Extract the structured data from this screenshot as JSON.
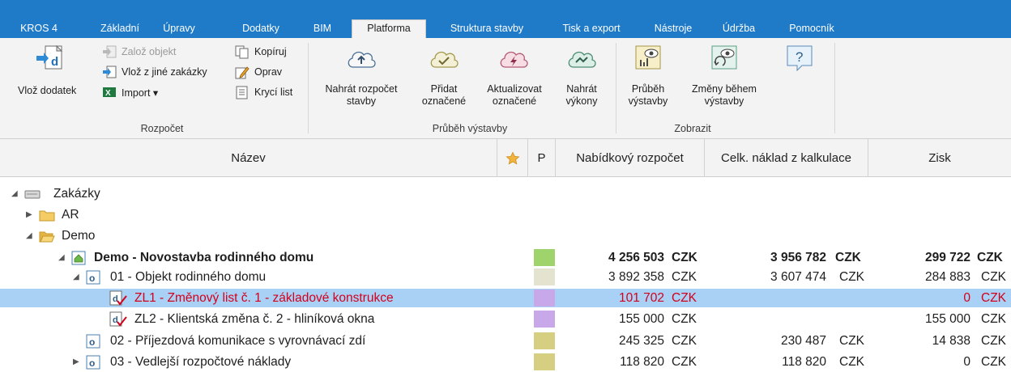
{
  "tabs": [
    {
      "label": "KROS 4"
    },
    {
      "label": "Základní"
    },
    {
      "label": "Úpravy"
    },
    {
      "label": "Dodatky"
    },
    {
      "label": "BIM"
    },
    {
      "label": "Platforma"
    },
    {
      "label": "Struktura stavby"
    },
    {
      "label": "Tisk a export"
    },
    {
      "label": "Nástroje"
    },
    {
      "label": "Údržba"
    },
    {
      "label": "Pomocník"
    }
  ],
  "active_tab": "Platforma",
  "ribbon": {
    "rozpocet": {
      "vloz_dodatek": "Vlož dodatek",
      "zaloz_objekt": "Založ objekt",
      "vloz_z_jine": "Vlož z jiné zakázky",
      "import": "Import ▾",
      "kopiruj": "Kopíruj",
      "oprav": "Oprav",
      "kryci_list": "Krycí list",
      "group": "Rozpočet"
    },
    "prubeh": {
      "nahrat_rozpocet_1": "Nahrát rozpočet",
      "nahrat_rozpocet_2": "stavby",
      "pridat_1": "Přidat",
      "pridat_2": "označené",
      "aktualizovat_1": "Aktualizovat",
      "aktualizovat_2": "označené",
      "nahrat_vykony_1": "Nahrát",
      "nahrat_vykony_2": "výkony",
      "group": "Průběh výstavby"
    },
    "zobrazit": {
      "prubeh_1": "Průběh",
      "prubeh_2": "výstavby",
      "zmeny_1": "Změny během",
      "zmeny_2": "výstavby",
      "help": "?",
      "group": "Zobrazit"
    }
  },
  "columns": {
    "nazev": "Název",
    "p": "P",
    "nabidkovy": "Nabídkový rozpočet",
    "naklad": "Celk. náklad z kalkulace",
    "zisk": "Zisk"
  },
  "tree": {
    "zakazky": "Zakázky",
    "ar": "AR",
    "demo": "Demo",
    "rows": [
      {
        "label": "Demo - Novostavba rodinného domu",
        "color": "#9ed46b",
        "nab": "4 256 503",
        "nab_cur": "CZK",
        "nak": "3 956 782",
        "nak_cur": "CZK",
        "zisk": "299 722",
        "zisk_cur": "CZK"
      },
      {
        "label": "01 - Objekt rodinného domu",
        "color": "#e3e3d0",
        "nab": "3 892 358",
        "nab_cur": "CZK",
        "nak": "3 607 474",
        "nak_cur": "CZK",
        "zisk": "284 883",
        "zisk_cur": "CZK"
      },
      {
        "label": "ZL1 - Změnový list č. 1 - základové konstrukce",
        "color": "#c9a8ea",
        "nab": "101 702",
        "nab_cur": "CZK",
        "nak": "",
        "nak_cur": "",
        "zisk": "0",
        "zisk_cur": "CZK"
      },
      {
        "label": "ZL2 - Klientská změna č. 2 - hliníková okna",
        "color": "#c9a8ea",
        "nab": "155 000",
        "nab_cur": "CZK",
        "nak": "",
        "nak_cur": "",
        "zisk": "155 000",
        "zisk_cur": "CZK"
      },
      {
        "label": "02 - Příjezdová komunikace s vyrovnávací zdí",
        "color": "#d6cf82",
        "nab": "245 325",
        "nab_cur": "CZK",
        "nak": "230 487",
        "nak_cur": "CZK",
        "zisk": "14 838",
        "zisk_cur": "CZK"
      },
      {
        "label": "03 - Vedlejší rozpočtové náklady",
        "color": "#d6cf82",
        "nab": "118 820",
        "nab_cur": "CZK",
        "nak": "118 820",
        "nak_cur": "CZK",
        "zisk": "0",
        "zisk_cur": "CZK"
      }
    ]
  }
}
